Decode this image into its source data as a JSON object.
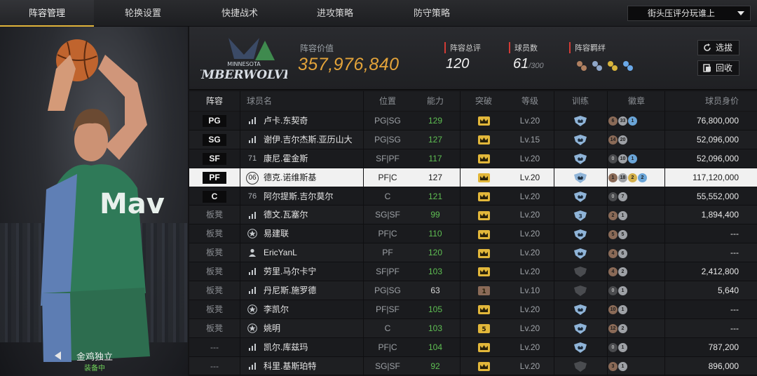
{
  "nav": {
    "tabs": [
      {
        "label": "阵容管理",
        "active": true
      },
      {
        "label": "轮换设置",
        "active": false
      },
      {
        "label": "快捷战术",
        "active": false
      },
      {
        "label": "进攻策略",
        "active": false
      },
      {
        "label": "防守策略",
        "active": false
      }
    ],
    "mode_select": "街头压评分玩谁上"
  },
  "player_panel": {
    "equip_name": "金鸡独立",
    "equip_status": "装备中"
  },
  "summary": {
    "team_logo_text": "TIMBERWOLVES",
    "team_logo_sub": "MINNESOTA",
    "lineup_value_label": "阵容价值",
    "lineup_value": "357,976,840",
    "total_rating_label": "阵容总评",
    "total_rating": "120",
    "player_count_label": "球员数",
    "player_count": "61",
    "player_count_max": "/300",
    "bond_label": "阵容羁绊",
    "btn_pick": "选拔",
    "btn_recycle": "回收"
  },
  "table": {
    "headers": {
      "pos": "阵容",
      "name": "球员名",
      "role": "位置",
      "ability": "能力",
      "break": "突破",
      "level": "等级",
      "train": "训练",
      "badge": "徽章",
      "value": "球员身价"
    },
    "rows": [
      {
        "pos": "PG",
        "starter": true,
        "num": "ıı|",
        "name": "卢卡.东契奇",
        "role": "PG|SG",
        "ability": "129",
        "break": "crown",
        "level": "Lv.20",
        "train": "on",
        "badges": [
          "#8a6a57:6",
          "#9ea1a6:33",
          "#6aa5d8:1"
        ],
        "value": "76,800,000"
      },
      {
        "pos": "SG",
        "starter": true,
        "num": "ıı|",
        "name": "谢伊.吉尔杰斯.亚历山大",
        "role": "PG|SG",
        "ability": "127",
        "break": "crown",
        "level": "Lv.15",
        "train": "on",
        "badges": [
          "#8a6a57:14",
          "#9ea1a6:20"
        ],
        "value": "52,096,000"
      },
      {
        "pos": "SF",
        "starter": true,
        "num": "71",
        "name": "康尼.霍金斯",
        "role": "SF|PF",
        "ability": "117",
        "break": "crown",
        "level": "Lv.20",
        "train": "on",
        "badges": [
          "#4a4b4e:0",
          "#9ea1a6:10",
          "#6aa5d8:1"
        ],
        "value": "52,096,000"
      },
      {
        "pos": "PF",
        "starter": true,
        "selected": true,
        "num": "06",
        "name": "德克.诺维斯基",
        "role": "PF|C",
        "ability": "127",
        "break": "crown",
        "level": "Lv.20",
        "train": "on",
        "badges": [
          "#8a6a57:1",
          "#9ea1a6:18",
          "#d4b04a:2",
          "#6aa5d8:2"
        ],
        "value": "117,120,000"
      },
      {
        "pos": "C",
        "starter": true,
        "num": "76",
        "name": "阿尔提斯.吉尔莫尔",
        "role": "C",
        "ability": "121",
        "break": "crown",
        "level": "Lv.20",
        "train": "on",
        "badges": [
          "#4a4b4e:0",
          "#9ea1a6:7"
        ],
        "value": "55,552,000"
      },
      {
        "pos": "板凳",
        "starter": false,
        "num": "ıı|",
        "name": "德文.瓦塞尔",
        "role": "SG|SF",
        "ability": "99",
        "break": "crown",
        "level": "Lv.20",
        "train": "3",
        "badges": [
          "#8a6a57:2",
          "#9ea1a6:1"
        ],
        "value": "1,894,400"
      },
      {
        "pos": "板凳",
        "starter": false,
        "num": "star",
        "name": "易建联",
        "role": "PF|C",
        "ability": "110",
        "break": "crown",
        "level": "Lv.20",
        "train": "on",
        "badges": [
          "#8a6a57:5",
          "#9ea1a6:5"
        ],
        "value": "---"
      },
      {
        "pos": "板凳",
        "starter": false,
        "num": "person",
        "name": "EricYanL",
        "role": "PF",
        "ability": "120",
        "break": "crown",
        "level": "Lv.20",
        "train": "on",
        "badges": [
          "#8a6a57:4",
          "#9ea1a6:6"
        ],
        "value": "---"
      },
      {
        "pos": "板凳",
        "starter": false,
        "num": "ıı|",
        "name": "劳里.马尔卡宁",
        "role": "SF|PF",
        "ability": "103",
        "break": "crown",
        "level": "Lv.20",
        "train": "off",
        "badges": [
          "#8a6a57:4",
          "#9ea1a6:2"
        ],
        "value": "2,412,800"
      },
      {
        "pos": "板凳",
        "starter": false,
        "num": "ıı|",
        "name": "丹尼斯.施罗德",
        "role": "PG|SG",
        "ability": "63",
        "break": "1",
        "level": "Lv.10",
        "train": "off",
        "badges": [
          "#4a4b4e:0",
          "#9ea1a6:1"
        ],
        "value": "5,640"
      },
      {
        "pos": "板凳",
        "starter": false,
        "num": "star",
        "name": "李凯尔",
        "role": "PF|SF",
        "ability": "105",
        "break": "crown",
        "level": "Lv.20",
        "train": "on",
        "badges": [
          "#8a6a57:10",
          "#9ea1a6:1"
        ],
        "value": "---"
      },
      {
        "pos": "板凳",
        "starter": false,
        "num": "star",
        "name": "姚明",
        "role": "C",
        "ability": "103",
        "break": "5",
        "level": "Lv.20",
        "train": "on",
        "badges": [
          "#8a6a57:12",
          "#9ea1a6:2"
        ],
        "value": "---"
      },
      {
        "pos": "---",
        "starter": false,
        "num": "ıı|",
        "name": "凯尔.库兹玛",
        "role": "PF|C",
        "ability": "104",
        "break": "crown",
        "level": "Lv.20",
        "train": "on",
        "badges": [
          "#4a4b4e:0",
          "#9ea1a6:1"
        ],
        "value": "787,200"
      },
      {
        "pos": "---",
        "starter": false,
        "num": "ıı|",
        "name": "科里.基斯珀特",
        "role": "SG|SF",
        "ability": "92",
        "break": "crown",
        "level": "Lv.20",
        "train": "off",
        "badges": [
          "#8a6a57:3",
          "#9ea1a6:1"
        ],
        "value": "896,000"
      }
    ]
  },
  "colors": {
    "accent_gold": "#e3a33a",
    "ability_green": "#5fbf53",
    "label_red": "#d23b35",
    "equip_green": "#6fd05a"
  }
}
